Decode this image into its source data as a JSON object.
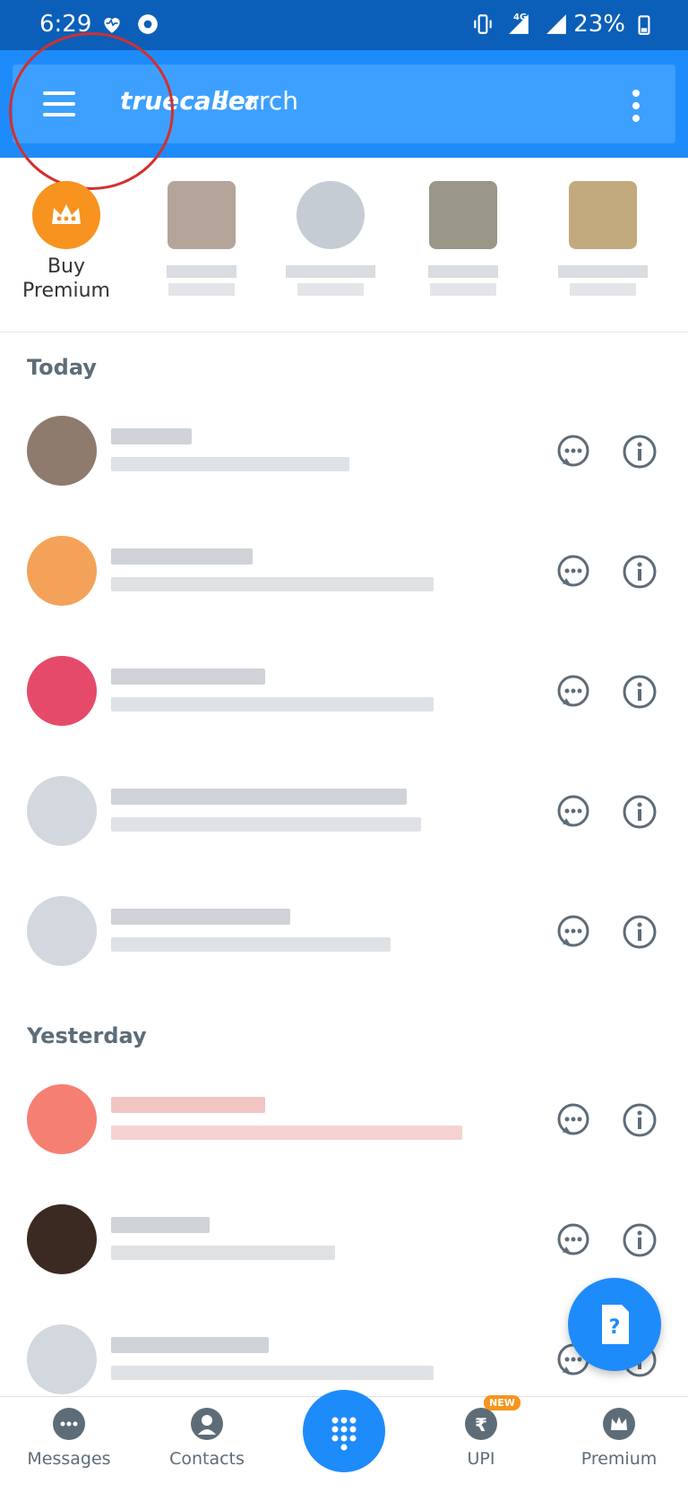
{
  "status_bar": {
    "time": "6:29",
    "network": "4G",
    "battery": "23%"
  },
  "app_bar": {
    "logo": "truecaller",
    "search_label": "search"
  },
  "favorites": {
    "buy_premium_label_line1": "Buy",
    "buy_premium_label_line2": "Premium"
  },
  "sections": {
    "today": "Today",
    "yesterday": "Yesterday"
  },
  "bottom_nav": {
    "messages": "Messages",
    "contacts": "Contacts",
    "upi": "UPI",
    "premium": "Premium",
    "new_badge": "NEW"
  },
  "colors": {
    "status_bar": "#0B5FB8",
    "app_bar": "#1E8BFA",
    "premium_orange": "#F7931E",
    "icon_gray": "#5E6C78"
  }
}
